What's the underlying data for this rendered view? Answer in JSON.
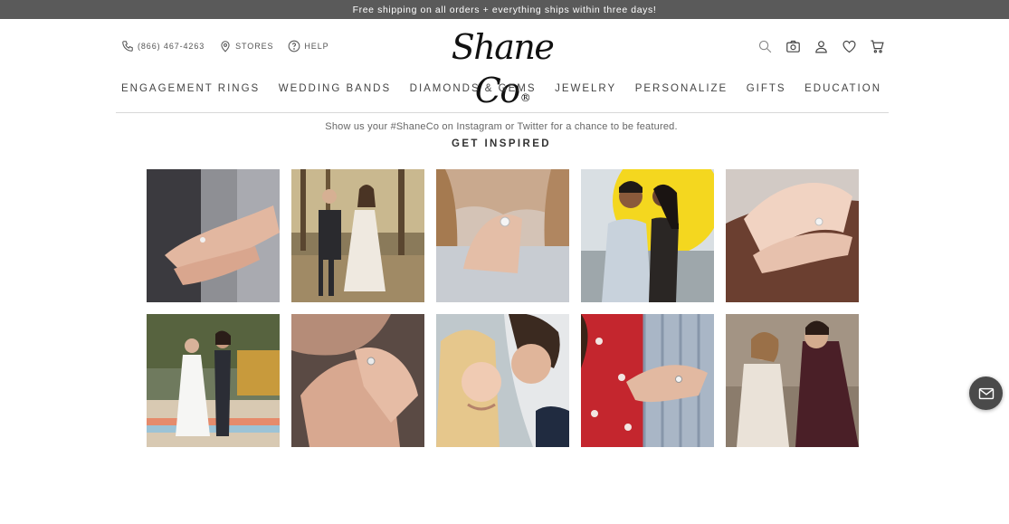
{
  "promo": {
    "text": "Free shipping on all orders + everything ships within three days!"
  },
  "header": {
    "phone": "(866) 467-4263",
    "stores": "STORES",
    "help": "HELP",
    "logo_text": "Shane Co",
    "logo_mark": "®",
    "icons": [
      "search-icon",
      "camera-icon",
      "account-icon",
      "heart-icon",
      "cart-icon"
    ]
  },
  "nav": {
    "items": [
      {
        "label": "ENGAGEMENT RINGS"
      },
      {
        "label": "WEDDING BANDS"
      },
      {
        "label": "DIAMONDS & GEMS"
      },
      {
        "label": "JEWELRY"
      },
      {
        "label": "PERSONALIZE"
      },
      {
        "label": "GIFTS"
      },
      {
        "label": "EDUCATION"
      }
    ]
  },
  "inspire": {
    "tagline": "Show us your #ShaneCo on Instagram or Twitter for a chance to be featured.",
    "title": "GET INSPIRED"
  },
  "colors": {
    "promo_bg": "#5a5a5a",
    "chat_bg": "#4a4a4a",
    "divider": "#d8d8d8"
  }
}
